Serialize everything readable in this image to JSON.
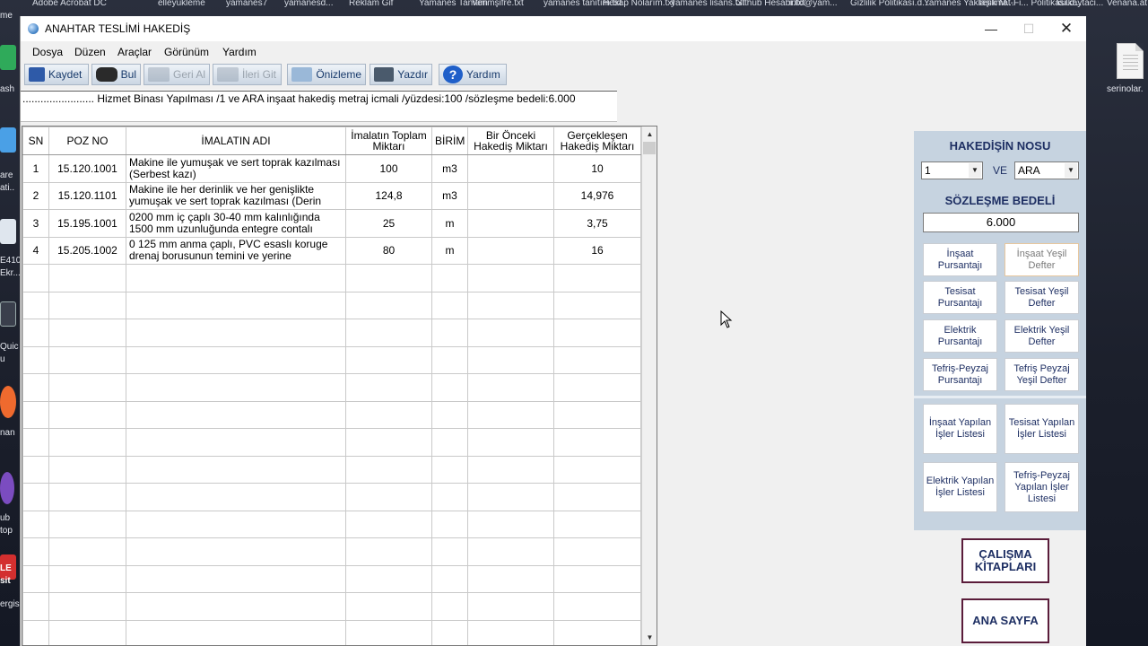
{
  "desktop": {
    "top_labels": [
      "Adobe Acrobat DC",
      "elleyukleme",
      "yamanes7",
      "yamanesd...",
      "Reklam Gif",
      "Yamanes Tanıtım",
      "Verimşifre.txt",
      "yamanes tanıtım.txt",
      "Hesap Nolarım.txt",
      "yamanes lisans.txt",
      "Github Hesabı.txt",
      "info@yam...",
      "Gizlilik Politikası.d...",
      "Yamanes Yaklaşık M...",
      "Teslimat-Fi... Politikası.d...",
      "kulkaytaci...",
      "Venana.at"
    ],
    "left_labels": [
      "me",
      "ash",
      "are",
      "ati..",
      "E410",
      "Ekr...",
      "Quic",
      "u",
      "nan",
      "ub",
      "top",
      "LE",
      "sit",
      "ergis"
    ],
    "right_icon_label": "serinolar."
  },
  "window": {
    "title": "ANAHTAR TESLİMİ HAKEDİŞ",
    "menu": [
      "Dosya",
      "Düzen",
      "Araçlar",
      "Görünüm",
      "Yardım"
    ],
    "toolbar": {
      "save": "Kaydet",
      "find": "Bul",
      "undo": "Geri Al",
      "redo": "İleri Git",
      "preview": "Önizleme",
      "print": "Yazdır",
      "help": "Yardım"
    },
    "caption": "........................ Hizmet Binası Yapılması /1 ve ARA inşaat hakediş metraj icmali /yüzdesi:100 /sözleşme bedeli:6.000"
  },
  "grid": {
    "headers": [
      "SN",
      "POZ NO",
      "İMALATIN ADI",
      "İmalatın Toplam Miktarı",
      "BİRİM",
      "Bir Önceki Hakediş Miktarı",
      "Gerçekleşen Hakediş Miktarı"
    ],
    "rows": [
      {
        "sn": "1",
        "poz": "15.120.1001",
        "ad": "Makine ile yumuşak ve sert toprak kazılması (Serbest kazı)",
        "toplam": "100",
        "birim": "m3",
        "onceki": "",
        "gercek": "10"
      },
      {
        "sn": "2",
        "poz": "15.120.1101",
        "ad": "Makine ile her derinlik ve her genişlikte yumuşak ve sert toprak kazılması (Derin",
        "toplam": "124,8",
        "birim": "m3",
        "onceki": "",
        "gercek": "14,976"
      },
      {
        "sn": "3",
        "poz": "15.195.1001",
        "ad": "0200 mm iç çaplı 30-40 mm kalınlığında 1500 mm uzunluğunda entegre contalı",
        "toplam": "25",
        "birim": "m",
        "onceki": "",
        "gercek": "3,75"
      },
      {
        "sn": "4",
        "poz": "15.205.1002",
        "ad": "0 125 mm anma çaplı, PVC esaslı koruge drenaj borusunun temini ve yerine",
        "toplam": "80",
        "birim": "m",
        "onceki": "",
        "gercek": "16"
      }
    ]
  },
  "panel": {
    "hakedis_title": "HAKEDİŞİN NOSU",
    "hakedis_no": "1",
    "ve": "VE",
    "hakedis_tip": "ARA",
    "bedel_title": "SÖZLEŞME BEDELİ",
    "bedel_value": "6.000",
    "buttons": [
      {
        "key": "insaat-pursantaj",
        "label": "İnşaat Pursantajı"
      },
      {
        "key": "insaat-yesil",
        "label": "İnşaat Yeşil Defter"
      },
      {
        "key": "tesisat-pursantaj",
        "label": "Tesisat Pursantajı"
      },
      {
        "key": "tesisat-yesil",
        "label": "Tesisat Yeşil Defter"
      },
      {
        "key": "elektrik-pursantaj",
        "label": "Elektrik Pursantajı"
      },
      {
        "key": "elektrik-yesil",
        "label": "Elektrik Yeşil Defter"
      },
      {
        "key": "tefris-pursantaj",
        "label": "Tefriş-Peyzaj Pursantajı"
      },
      {
        "key": "tefris-yesil",
        "label": "Tefriş Peyzaj Yeşil Defter"
      }
    ],
    "list_buttons": [
      {
        "key": "insaat-list",
        "label": "İnşaat Yapılan İşler Listesi"
      },
      {
        "key": "tesisat-list",
        "label": "Tesisat Yapılan İşler Listesi"
      },
      {
        "key": "elektrik-list",
        "label": "Elektrik Yapılan İşler Listesi"
      },
      {
        "key": "tefris-list",
        "label": "Tefriş-Peyzaj Yapılan İşler Listesi"
      }
    ],
    "calisma": "ÇALIŞMA KİTAPLARI",
    "ana_sayfa": "ANA SAYFA"
  },
  "colors": {
    "panel_bg": "#c6d3e0",
    "title_color": "#1e2f63",
    "big_btn_border": "#5a1c3a"
  }
}
